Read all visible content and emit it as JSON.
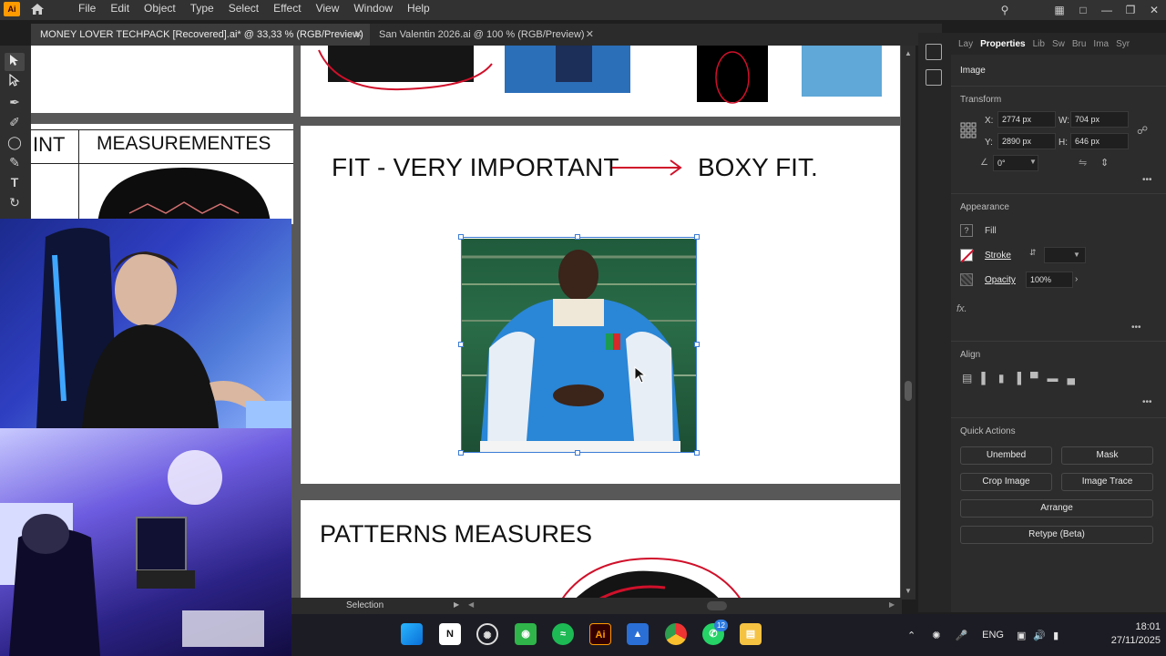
{
  "app": {
    "logo": "Ai",
    "menu": [
      "File",
      "Edit",
      "Object",
      "Type",
      "Select",
      "Effect",
      "View",
      "Window",
      "Help"
    ]
  },
  "tabs": [
    {
      "label": "MONEY LOVER TECHPACK [Recovered].ai* @ 33,33 % (RGB/Preview)",
      "close": "✕"
    },
    {
      "label": "San Valentin 2026.ai @ 100 % (RGB/Preview)",
      "close": "✕"
    }
  ],
  "canvas": {
    "left_artboard": {
      "col1": "INT",
      "col2": "MEASUREMENTES"
    },
    "fit_title": "FIT - VERY IMPORTANT",
    "fit_value": "BOXY FIT.",
    "patterns_title": "PATTERNS MEASURES"
  },
  "status": {
    "tool": "Selection"
  },
  "panel": {
    "tabs": [
      "Lay",
      "Properties",
      "Lib",
      "Sw",
      "Bru",
      "Ima",
      "Syr"
    ],
    "selection_type": "Image",
    "transform": {
      "title": "Transform",
      "x_label": "X:",
      "x": "2774 px",
      "y_label": "Y:",
      "y": "2890 px",
      "w_label": "W:",
      "w": "704 px",
      "h_label": "H:",
      "h": "646 px",
      "angle": "0°"
    },
    "appearance": {
      "title": "Appearance",
      "fill": "Fill",
      "stroke": "Stroke",
      "opacity_label": "Opacity",
      "opacity": "100%",
      "fx": "fx."
    },
    "align": {
      "title": "Align"
    },
    "quick_actions": {
      "title": "Quick Actions",
      "unembed": "Unembed",
      "mask": "Mask",
      "crop": "Crop Image",
      "trace": "Image Trace",
      "arrange": "Arrange",
      "retype": "Retype (Beta)"
    }
  },
  "taskbar": {
    "lang": "ENG",
    "time": "18:01",
    "date": "27/11/2025",
    "whatsapp_badge": "12"
  }
}
